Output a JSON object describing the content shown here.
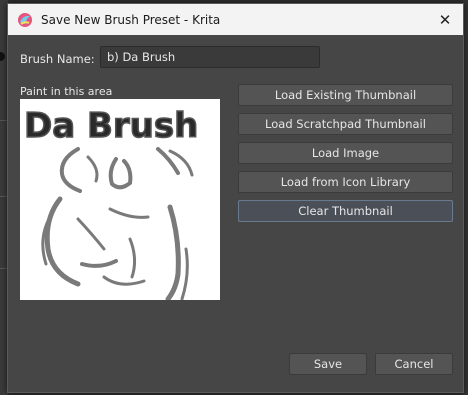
{
  "window": {
    "title": "Save New Brush Preset - Krita",
    "close_symbol": "✕"
  },
  "form": {
    "name_label": "Brush Name:",
    "name_value": "b) Da Brush",
    "paint_label": "Paint in this area",
    "thumbnail_text": "Da Brush"
  },
  "buttons": {
    "load_existing": "Load Existing Thumbnail",
    "load_scratchpad": "Load Scratchpad Thumbnail",
    "load_image": "Load Image",
    "load_icon_library": "Load from Icon Library",
    "clear_thumbnail": "Clear Thumbnail",
    "save": "Save",
    "cancel": "Cancel"
  },
  "colors": {
    "dialog_bg": "#464646",
    "titlebar_bg": "#f3f3f3",
    "button_bg": "#545454",
    "focus_border": "#6a7a8e"
  }
}
